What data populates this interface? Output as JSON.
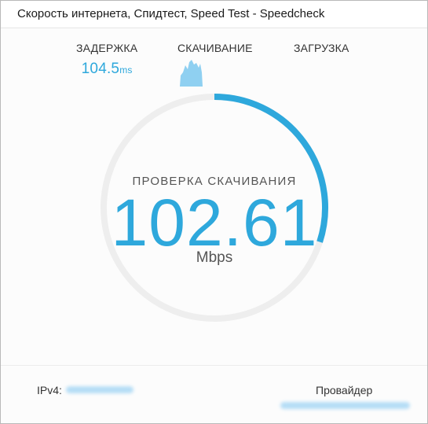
{
  "window": {
    "title": "Скорость интернета, Спидтест, Speed Test - Speedcheck"
  },
  "stats": {
    "latency": {
      "label": "ЗАДЕРЖКА",
      "value": "104.5",
      "unit": "ms"
    },
    "download": {
      "label": "СКАЧИВАНИЕ"
    },
    "upload": {
      "label": "ЗАГРУЗКА"
    }
  },
  "gauge": {
    "label": "ПРОВЕРКА СКАЧИВАНИЯ",
    "value": "102.61",
    "unit": "Mbps",
    "progress_fraction": 0.3
  },
  "footer": {
    "ipv4_label": "IPv4:",
    "provider_label": "Провайдер"
  },
  "colors": {
    "accent": "#2ea8dc",
    "track": "#eeeeee",
    "spark_fill": "#8fd0f1"
  }
}
